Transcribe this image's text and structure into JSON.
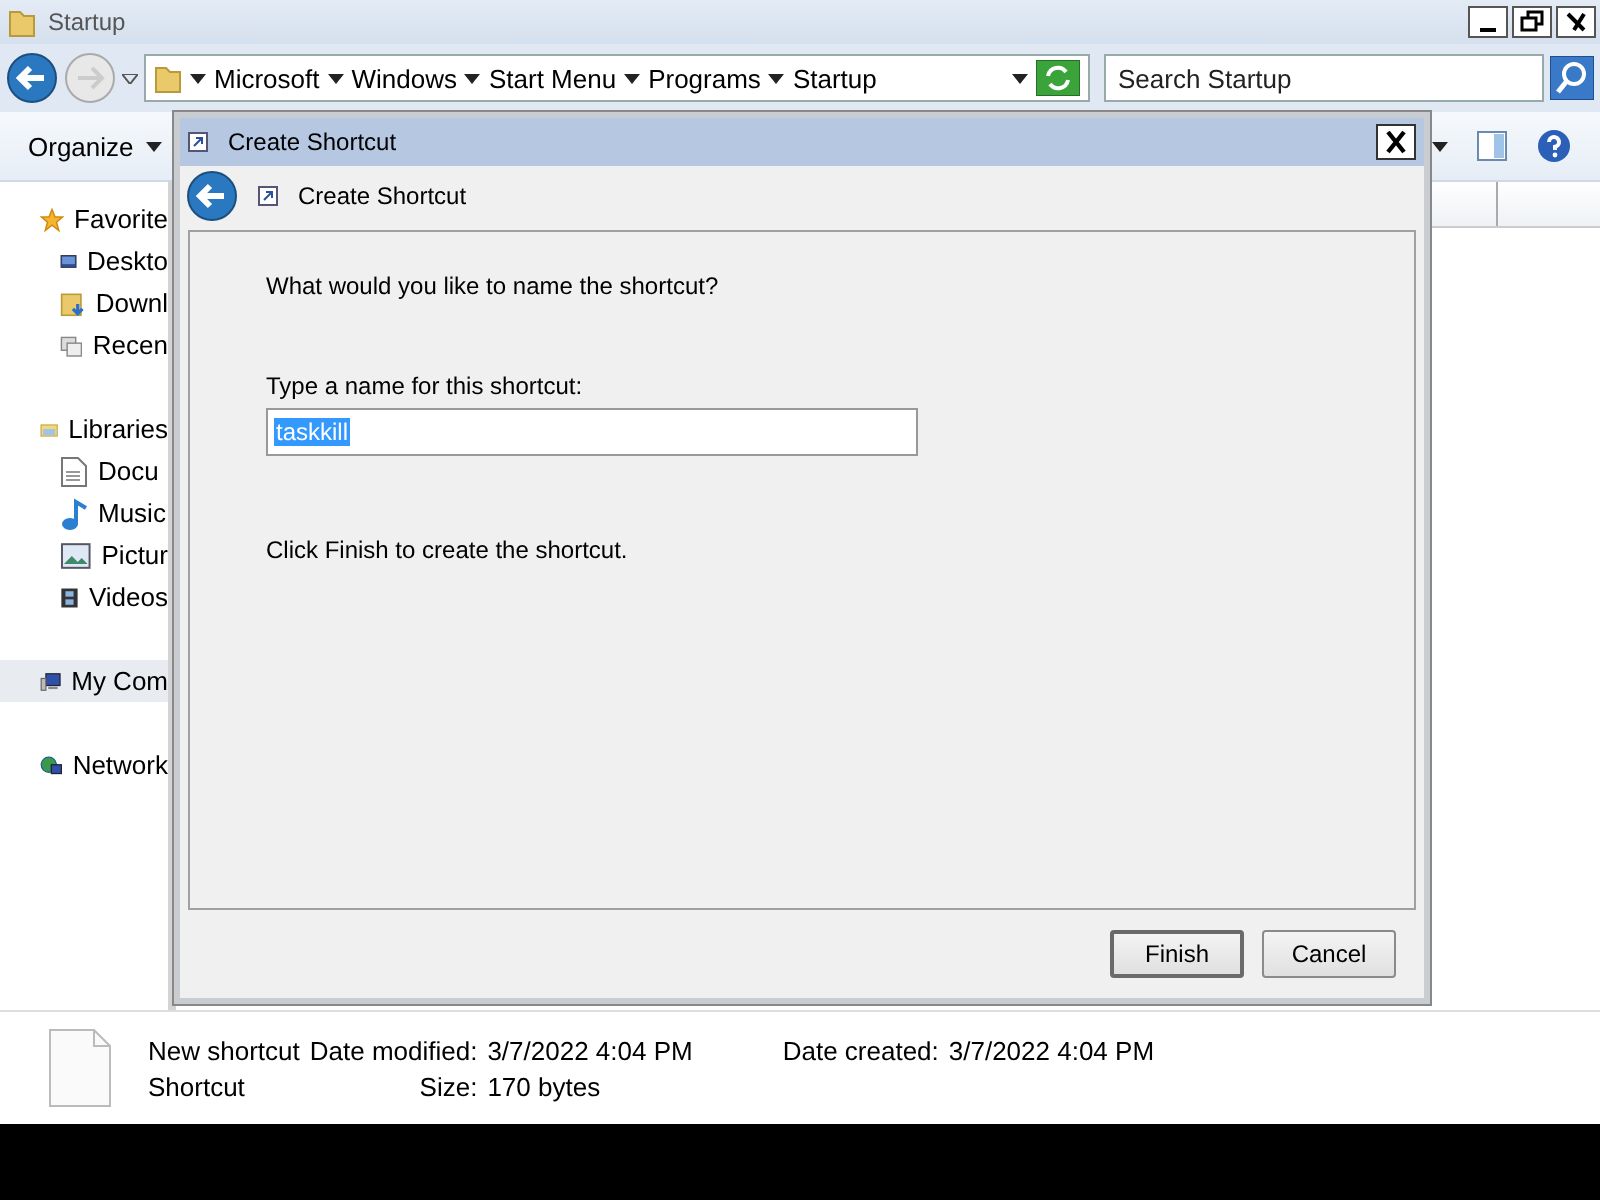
{
  "explorer": {
    "title": "Startup",
    "address": {
      "forward_disabled": true,
      "breadcrumbs": [
        "Microsoft",
        "Windows",
        "Start Menu",
        "Programs",
        "Startup"
      ]
    },
    "search": {
      "placeholder": "Search Startup"
    },
    "toolbar": {
      "organize": "Organize"
    },
    "nav": [
      {
        "label": "Favorite",
        "kind": "favorites",
        "selected": false,
        "children": [
          {
            "label": "Deskto",
            "kind": "desktop",
            "selected": false
          },
          {
            "label": "Downl",
            "kind": "downloads",
            "selected": false
          },
          {
            "label": "Recen",
            "kind": "recent",
            "selected": false
          }
        ]
      },
      {
        "label": "Libraries",
        "kind": "libraries",
        "selected": false,
        "children": [
          {
            "label": "Docu",
            "kind": "documents",
            "selected": false
          },
          {
            "label": "Music",
            "kind": "music",
            "selected": false
          },
          {
            "label": "Pictur",
            "kind": "pictures",
            "selected": false
          },
          {
            "label": "Videos",
            "kind": "videos",
            "selected": false
          }
        ]
      },
      {
        "label": "My Com",
        "kind": "computer",
        "selected": true
      },
      {
        "label": "Network",
        "kind": "network",
        "selected": false
      }
    ],
    "details": {
      "name": "New shortcut",
      "type": "Shortcut",
      "fields": [
        {
          "label": "Date modified:",
          "value": "3/7/2022 4:04 PM"
        },
        {
          "label": "Date created:",
          "value": "3/7/2022 4:04 PM"
        },
        {
          "label": "Size:",
          "value": "170 bytes"
        }
      ]
    }
  },
  "dialog": {
    "title": "Create Shortcut",
    "heading": "Create Shortcut",
    "question": "What would you like to name the shortcut?",
    "field": {
      "label": "Type a name for this shortcut:",
      "value": "taskkill",
      "selected": true
    },
    "hint": "Click Finish to create the shortcut.",
    "buttons": [
      {
        "label": "Finish",
        "default": true
      },
      {
        "label": "Cancel",
        "default": false
      }
    ]
  }
}
